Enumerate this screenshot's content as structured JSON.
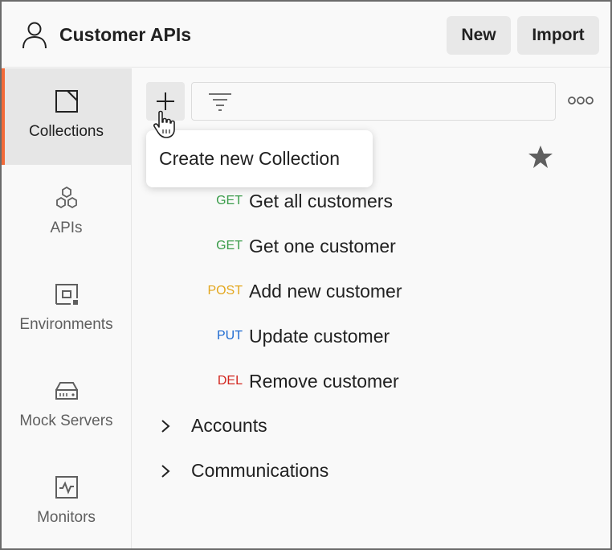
{
  "header": {
    "workspace_title": "Customer APIs",
    "new_label": "New",
    "import_label": "Import"
  },
  "sidebar": {
    "items": [
      {
        "label": "Collections",
        "icon": "collections-icon",
        "active": true
      },
      {
        "label": "APIs",
        "icon": "apis-icon",
        "active": false
      },
      {
        "label": "Environments",
        "icon": "environments-icon",
        "active": false
      },
      {
        "label": "Mock Servers",
        "icon": "mock-servers-icon",
        "active": false
      },
      {
        "label": "Monitors",
        "icon": "monitors-icon",
        "active": false
      }
    ]
  },
  "toolbar": {
    "add_icon": "plus-icon",
    "filter_icon": "filter-icon",
    "more_icon": "more-options-icon",
    "tooltip": "Create new Collection"
  },
  "requests": [
    {
      "method": "GET",
      "method_color": "#3a9c4a",
      "name": "Get all customers"
    },
    {
      "method": "GET",
      "method_color": "#3a9c4a",
      "name": "Get one customer"
    },
    {
      "method": "POST",
      "method_color": "#e3a71f",
      "name": "Add new customer"
    },
    {
      "method": "PUT",
      "method_color": "#1f6bd1",
      "name": "Update customer"
    },
    {
      "method": "DEL",
      "method_color": "#d2261f",
      "name": "Remove customer"
    }
  ],
  "folders": [
    {
      "name": "Accounts"
    },
    {
      "name": "Communications"
    }
  ],
  "colors": {
    "accent": "#f26b3a",
    "active_bg": "#e6e6e6",
    "button_bg": "#e8e8e8"
  }
}
